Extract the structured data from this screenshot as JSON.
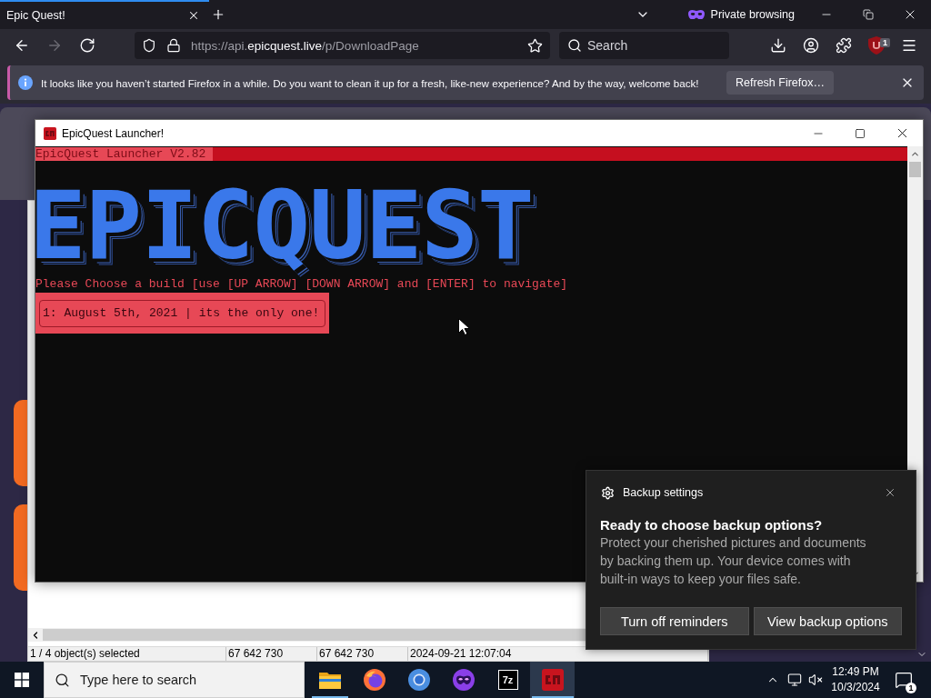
{
  "browser": {
    "tabs": [
      {
        "title": "Epic Quest!",
        "selected": true
      }
    ],
    "private_label": "Private browsing",
    "nav_buttons": [
      {
        "kind": "back",
        "disabled": false
      },
      {
        "kind": "forward",
        "disabled": true
      },
      {
        "kind": "reload",
        "disabled": false
      }
    ],
    "address": {
      "prefix": "https://api.",
      "host": "epicquest.live",
      "path": "/p/DownloadPage"
    },
    "search": {
      "placeholder": "Search"
    },
    "extension_badge": "1",
    "notice": {
      "message": "It looks like you haven’t started Firefox in a while. Do you want to clean it up for a fresh, like-new experience? And by the way, welcome back!",
      "button": "Refresh Firefox…"
    }
  },
  "file_window": {
    "status_bar": [
      "1 / 4 object(s) selected",
      "67 642 730",
      "67 642 730",
      "2024-09-21 12:07:04"
    ]
  },
  "launcher": {
    "title": "EpicQuest Launcher!",
    "header": "EpicQuest Launcher V2.82",
    "logo": "EPICQUEST",
    "prompt": "Please Choose a build [use [UP ARROW] [DOWN ARROW] and [ENTER] to navigate]",
    "builds": [
      {
        "label": "1: August 5th, 2021 | its the only one!",
        "selected": true
      }
    ]
  },
  "notification": {
    "source": "Backup settings",
    "title": "Ready to choose backup options?",
    "body": "Protect your cherished pictures and documents by backing them up. Your device comes with built-in ways to keep your files safe.",
    "buttons": [
      "Turn off reminders",
      "View backup options"
    ]
  },
  "taskbar": {
    "search": {
      "placeholder": "Type here to search"
    },
    "apps": [
      {
        "kind": "explorer",
        "running": true,
        "selected": false
      },
      {
        "kind": "firefox",
        "running": false,
        "selected": false
      },
      {
        "kind": "ring",
        "running": false,
        "selected": false
      },
      {
        "kind": "private",
        "running": false,
        "selected": false
      },
      {
        "kind": "archiver",
        "label": "7z",
        "running": false,
        "selected": false
      },
      {
        "kind": "launcher",
        "running": true,
        "selected": true
      }
    ],
    "time": "12:49 PM",
    "date": "10/3/2024",
    "notification_count": "1"
  }
}
